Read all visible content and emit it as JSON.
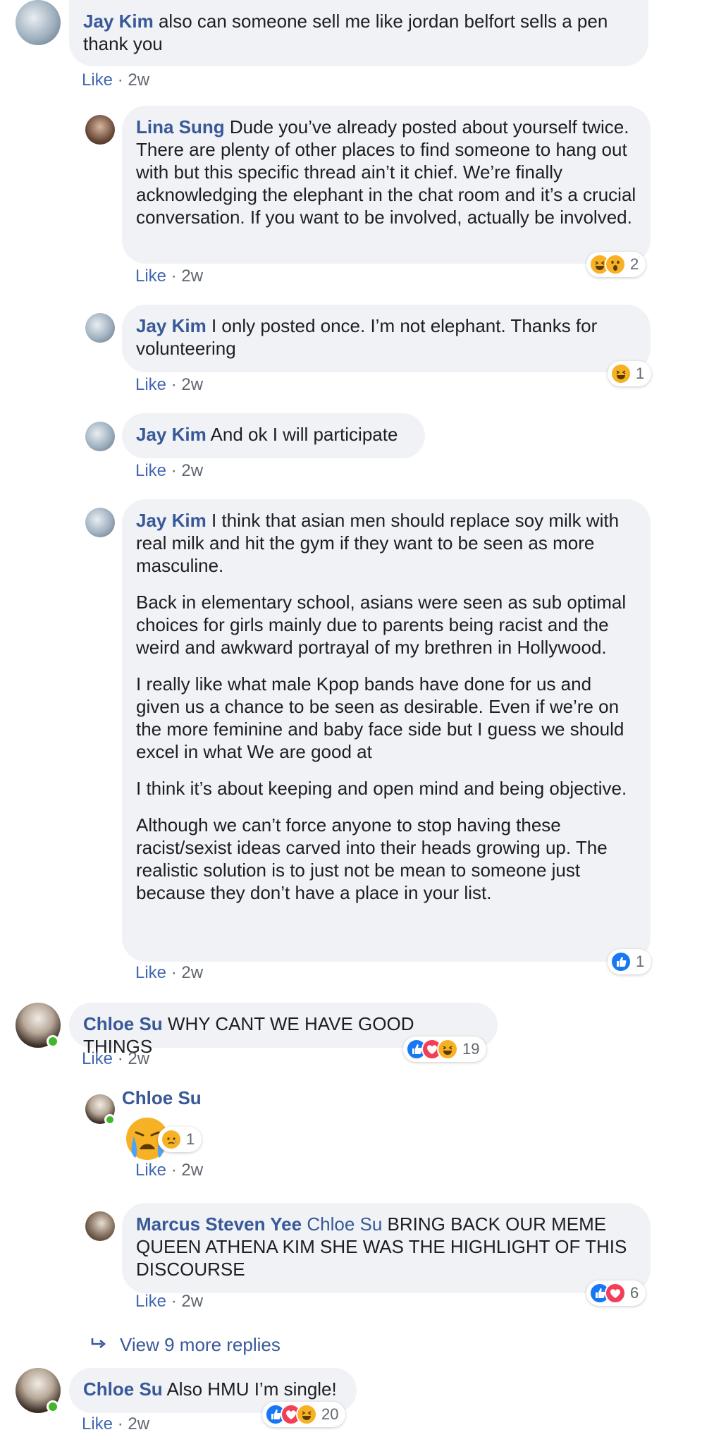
{
  "colors": {
    "link": "#385898",
    "bubble": "#f0f2f5",
    "meta": "#616770",
    "online": "#42b72a"
  },
  "actions": {
    "like": "Like",
    "sep": " · "
  },
  "comments": [
    {
      "author": "Jay Kim",
      "text": "also can someone sell me like jordan belfort sells a pen thank you",
      "time": "2w"
    },
    {
      "author": "Lina Sung",
      "text": "Dude you’ve already posted about yourself twice. There are plenty of other places to find someone to hang out with but this specific thread ain’t it chief. We’re finally acknowledging the elephant in the chat room and it’s a crucial conversation. If you want to be involved, actually be involved.",
      "time": "2w",
      "reaction_count": "2",
      "reactions": [
        "haha-icon",
        "wow-icon"
      ]
    },
    {
      "author": "Jay Kim",
      "text": "I only posted once. I’m not elephant. Thanks for volunteering",
      "time": "2w",
      "reaction_count": "1",
      "reactions": [
        "haha-icon"
      ]
    },
    {
      "author": "Jay Kim",
      "text": "And ok I will participate",
      "time": "2w"
    },
    {
      "author": "Jay Kim",
      "paragraphs": [
        "I think that asian men should replace soy milk with real milk and hit the gym if they want to be seen as more masculine.",
        "Back in elementary school, asians were seen as sub optimal choices for girls mainly due to parents being racist and the weird and awkward portrayal of my brethren in Hollywood.",
        "I really like what male Kpop bands have done for us and given us a chance to be seen as desirable. Even if we’re on the more feminine and baby face side but I guess we should excel in what We are good at",
        "I think it’s about keeping and open mind and being objective.",
        "Although we can’t force anyone to stop having these racist/sexist ideas carved into their heads growing up. The realistic solution is to just not be mean to someone just because they don’t have a place in your list."
      ],
      "time": "2w",
      "reaction_count": "1",
      "reactions": [
        "like-icon"
      ]
    },
    {
      "author": "Chloe Su",
      "text": "WHY CANT WE HAVE GOOD THINGS",
      "time": "2w",
      "reaction_count": "19",
      "reactions": [
        "like-icon",
        "love-icon",
        "haha-icon"
      ]
    },
    {
      "author": "Chloe Su",
      "sticker": "crying-face-sticker",
      "time": "2w",
      "reaction_count": "1",
      "reactions": [
        "sad-icon"
      ]
    },
    {
      "author": "Marcus Steven Yee",
      "mention": "Chloe Su",
      "text": "BRING BACK OUR MEME QUEEN ATHENA KIM SHE WAS THE HIGHLIGHT OF THIS DISCOURSE",
      "time": "2w",
      "reaction_count": "6",
      "reactions": [
        "like-icon",
        "love-icon"
      ]
    },
    {
      "author": "Chloe Su",
      "text": "Also HMU I’m single!",
      "time": "2w",
      "reaction_count": "20",
      "reactions": [
        "like-icon",
        "love-icon",
        "haha-icon"
      ]
    }
  ],
  "view_more": "View 9 more replies"
}
